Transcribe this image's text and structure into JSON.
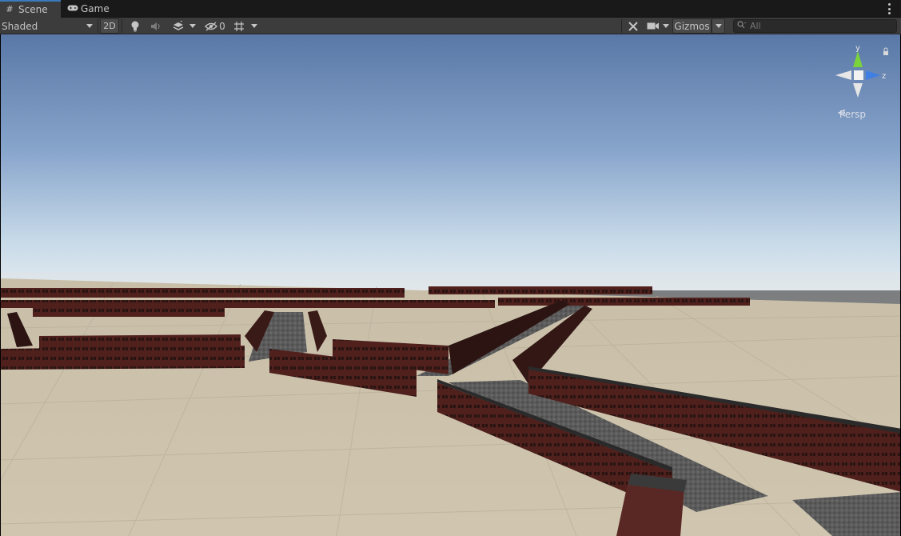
{
  "tabs": [
    {
      "label": "Scene",
      "icon": "hash-grid-icon",
      "active": true
    },
    {
      "label": "Game",
      "icon": "gamepad-icon",
      "active": false
    }
  ],
  "toolbar": {
    "draw_mode": "Shaded",
    "toggle_2d": "2D",
    "hidden_count": "0",
    "gizmos_label": "Gizmos",
    "search_placeholder": "All"
  },
  "gizmo": {
    "y_label": "y",
    "z_label": "z",
    "projection": "Persp"
  },
  "colors": {
    "tab_active_accent": "#3a79bb",
    "gizmo_y": "#7ad33a",
    "gizmo_z": "#3f7fe3",
    "ground": "#cfc4ae",
    "building_brick": "#5a2520",
    "road": "#5b5b5b"
  }
}
